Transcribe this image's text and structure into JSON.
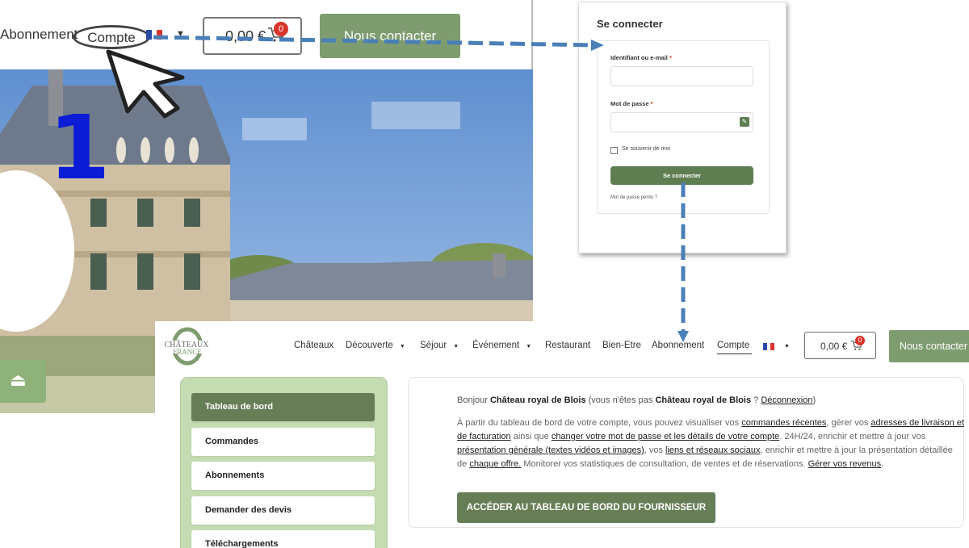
{
  "step1": {
    "nav_abonnement": "Abonnement",
    "nav_compte": "Compte",
    "cart_total": "0,00 €",
    "cart_count": "0",
    "contact_label": "Nous contacter",
    "step_number": "1",
    "scroll_top_icon": "⏏"
  },
  "login": {
    "title": "Se connecter",
    "username_label": "Identifiant ou e-mail",
    "required_mark": "*",
    "password_label": "Mot de passe",
    "remember_label": "Se souvenir de moi",
    "submit_label": "Se connecter",
    "lost_password": "Mot de passe perdu ?"
  },
  "account": {
    "logo_text": "CHÂTEAUX FRANCE",
    "menu": [
      {
        "label": "Châteaux"
      },
      {
        "label": "Découverte",
        "has_dropdown": true
      },
      {
        "label": "Séjour",
        "has_dropdown": true
      },
      {
        "label": "Événement",
        "has_dropdown": true
      },
      {
        "label": "Restaurant"
      },
      {
        "label": "Bien-Etre"
      },
      {
        "label": "Abonnement"
      },
      {
        "label": "Compte",
        "active": true
      }
    ],
    "cart_total": "0,00 €",
    "cart_count": "0",
    "contact_label": "Nous contacter",
    "sidebar": [
      {
        "label": "Tableau de bord",
        "active": true
      },
      {
        "label": "Commandes"
      },
      {
        "label": "Abonnements"
      },
      {
        "label": "Demander des devis"
      },
      {
        "label": "Téléchargements"
      }
    ],
    "greeting": {
      "prefix": "Bonjour",
      "name": "Château royal de Blois",
      "middle": "(vous n'êtes pas",
      "name2": "Château royal de Blois",
      "question": "?",
      "logout": "Déconnexion",
      "close": ")"
    },
    "intro": {
      "t1": "À partir du tableau de bord de votre compte, vous pouvez visualiser vos",
      "l1": "commandes récentes",
      "t2": ", gérer vos",
      "l2": "adresses de livraison et de facturation",
      "t3": " ainsi que",
      "l3": "changer votre mot de passe et les détails de votre compte",
      "t4": ". 24H/24, enrichir et mettre à jour vos",
      "l4": "présentation générale (textes vidéos et images)",
      "t5": ", vos",
      "l5": "liens et réseaux sociaux",
      "t6": ", enrichir et mettre à jour la présentation détaillée de",
      "l6": "chaque offre.",
      "t7": " Monitorer vos statistiques de consultation, de ventes et de réservations.",
      "l7": "Gérer vos revenus",
      "t8": "."
    },
    "dashboard_button": "ACCÉDER AU TABLEAU DE BORD DU FOURNISSEUR"
  },
  "colors": {
    "brand_green": "#677d56",
    "sidebar_green": "#c5dcb2",
    "arrow_blue": "#4a7fb8",
    "step_blue": "#0a1cd6",
    "badge_red": "#d9342b"
  }
}
